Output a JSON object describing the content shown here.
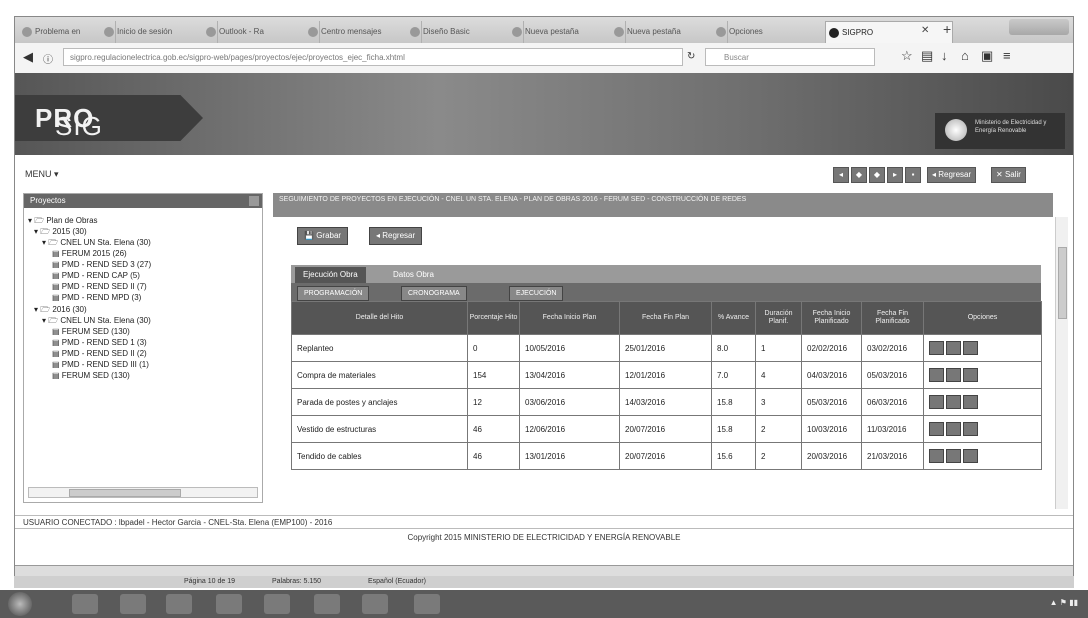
{
  "browser": {
    "tabs": [
      {
        "label": "Problema en"
      },
      {
        "label": "Inicio de sesión"
      },
      {
        "label": "Outlook - Ra"
      },
      {
        "label": "Centro mensajes"
      },
      {
        "label": "Diseño Basic"
      },
      {
        "label": "Nueva pestaña"
      },
      {
        "label": "Nueva pestaña"
      },
      {
        "label": "Opciones"
      },
      {
        "label": "SIGPRO",
        "active": true
      }
    ],
    "url": "sigpro.regulacionelectrica.gob.ec/sigpro-web/pages/proyectos/ejec/proyectos_ejec_ficha.xhtml",
    "search_placeholder": "Buscar"
  },
  "header": {
    "logo_sig": "SIG",
    "logo_pro": "PRO",
    "emblem_text": "Ministerio de Electricidad y Energía Renovable"
  },
  "menu": {
    "label": "MENU",
    "text_buttons": [
      "Regresar",
      "Salir"
    ]
  },
  "tree": {
    "title": "Proyectos",
    "nodes": [
      {
        "label": "Plan de Obras",
        "level": 0
      },
      {
        "label": "2015 (30)",
        "level": 1
      },
      {
        "label": "CNEL UN Sta. Elena (30)",
        "level": 2
      },
      {
        "label": "FERUM 2015 (26)",
        "level": 3
      },
      {
        "label": "PMD - REND SED 3 (27)",
        "level": 3
      },
      {
        "label": "PMD - REND CAP (5)",
        "level": 3
      },
      {
        "label": "PMD - REND SED II (7)",
        "level": 3
      },
      {
        "label": "PMD - REND MPD (3)",
        "level": 3
      },
      {
        "label": "2016 (30)",
        "level": 1
      },
      {
        "label": "CNEL UN Sta. Elena (30)",
        "level": 2
      },
      {
        "label": "FERUM SED (130)",
        "level": 3
      },
      {
        "label": "PMD - REND SED 1 (3)",
        "level": 3
      },
      {
        "label": "PMD - REND SED II (2)",
        "level": 3
      },
      {
        "label": "PMD - REND SED III (1)",
        "level": 3
      },
      {
        "label": "FERUM SED (130)",
        "level": 3
      }
    ]
  },
  "main": {
    "heading": "SEGUIMIENTO DE PROYECTOS EN EJECUCIÓN - CNEL UN STA. ELENA - PLAN DE OBRAS 2016 - FERUM SED - CONSTRUCCIÓN DE REDES",
    "action_buttons": [
      "Grabar",
      "Regresar"
    ],
    "outer_tabs": [
      "Ejecución Obra",
      "Datos Obra"
    ],
    "inner_tabs": [
      "PROGRAMACIÓN",
      "CRONOGRAMA",
      "EJECUCIÓN"
    ],
    "columns": [
      "Detalle del Hito",
      "Porcentaje Hito",
      "Fecha Inicio Plan",
      "Fecha Fin Plan",
      "% Avance",
      "Duración Planif.",
      "Fecha Inicio Planificado",
      "Fecha Fin Planificado",
      "Opciones"
    ],
    "rows": [
      [
        "Replanteo",
        "0",
        "10/05/2016",
        "25/01/2016",
        "8.0",
        "1",
        "02/02/2016",
        "03/02/2016"
      ],
      [
        "Compra de materiales",
        "154",
        "13/04/2016",
        "12/01/2016",
        "7.0",
        "4",
        "04/03/2016",
        "05/03/2016"
      ],
      [
        "Parada de postes y anclajes",
        "12",
        "03/06/2016",
        "14/03/2016",
        "15.8",
        "3",
        "05/03/2016",
        "06/03/2016"
      ],
      [
        "Vestido de estructuras",
        "46",
        "12/06/2016",
        "20/07/2016",
        "15.8",
        "2",
        "10/03/2016",
        "11/03/2016"
      ],
      [
        "Tendido de cables",
        "46",
        "13/01/2016",
        "20/07/2016",
        "15.6",
        "2",
        "20/03/2016",
        "21/03/2016"
      ]
    ]
  },
  "footer": {
    "user_line": "USUARIO CONECTADO : lbpadel - Hector Garcia - CNEL-Sta. Elena (EMP100) - 2016",
    "copyright": "Copyright 2015 MINISTERIO DE ELECTRICIDAD Y ENERGÍA RENOVABLE"
  },
  "word_status": {
    "page": "Página 10 de 19",
    "words": "Palabras: 5.150",
    "language": "Español (Ecuador)"
  }
}
